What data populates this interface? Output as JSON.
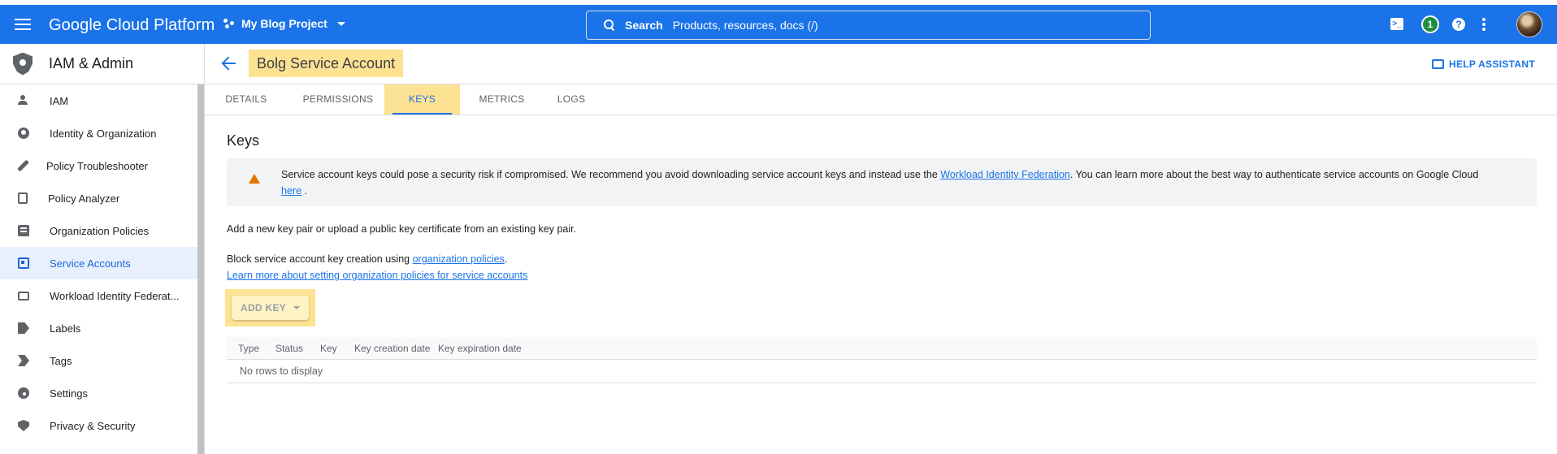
{
  "topbar": {
    "brand": "Google Cloud Platform",
    "project": "My Blog Project",
    "search_label": "Search",
    "search_hint": "Products, resources, docs (/)",
    "notifications_count": "1",
    "terminal_icon": "cloud-shell-icon",
    "help_icon": "help-icon",
    "more_icon": "more-vert-icon"
  },
  "sidebar": {
    "title": "IAM & Admin",
    "items": [
      {
        "label": "IAM",
        "icon": "person-add-icon"
      },
      {
        "label": "Identity & Organization",
        "icon": "account-circle-icon"
      },
      {
        "label": "Policy Troubleshooter",
        "icon": "wrench-icon"
      },
      {
        "label": "Policy Analyzer",
        "icon": "document-search-icon"
      },
      {
        "label": "Organization Policies",
        "icon": "list-icon"
      },
      {
        "label": "Service Accounts",
        "icon": "service-account-icon",
        "active": true
      },
      {
        "label": "Workload Identity Federat...",
        "icon": "id-card-icon"
      },
      {
        "label": "Labels",
        "icon": "label-icon"
      },
      {
        "label": "Tags",
        "icon": "tag-icon"
      },
      {
        "label": "Settings",
        "icon": "gear-icon"
      },
      {
        "label": "Privacy & Security",
        "icon": "shield-icon"
      }
    ]
  },
  "header": {
    "title": "Bolg Service Account",
    "help_assistant": "HELP ASSISTANT"
  },
  "tabs": [
    {
      "label": "DETAILS"
    },
    {
      "label": "PERMISSIONS"
    },
    {
      "label": "KEYS",
      "active": true
    },
    {
      "label": "METRICS"
    },
    {
      "label": "LOGS"
    }
  ],
  "keys": {
    "heading": "Keys",
    "warning_pre": "Service account keys could pose a security risk if compromised. We recommend you avoid downloading service account keys and instead use the",
    "warning_link1": "Workload Identity Federation",
    "warning_mid": ". You can learn more about the best way to authenticate service accounts on Google Cloud",
    "warning_link2": "here",
    "warning_post": ".",
    "add_info": "Add a new key pair or upload a public key certificate from an existing key pair.",
    "block_pre": "Block service account key creation using",
    "block_link": "organization policies",
    "block_post": ".",
    "learn_more": "Learn more about setting organization policies for service accounts",
    "add_key_button": "ADD KEY",
    "table": {
      "columns": [
        "Type",
        "Status",
        "Key",
        "Key creation date",
        "Key expiration date"
      ],
      "empty_text": "No rows to display"
    }
  },
  "colors": {
    "primary": "#1a73e8",
    "highlight": "#fde293",
    "warning": "#e37400"
  }
}
